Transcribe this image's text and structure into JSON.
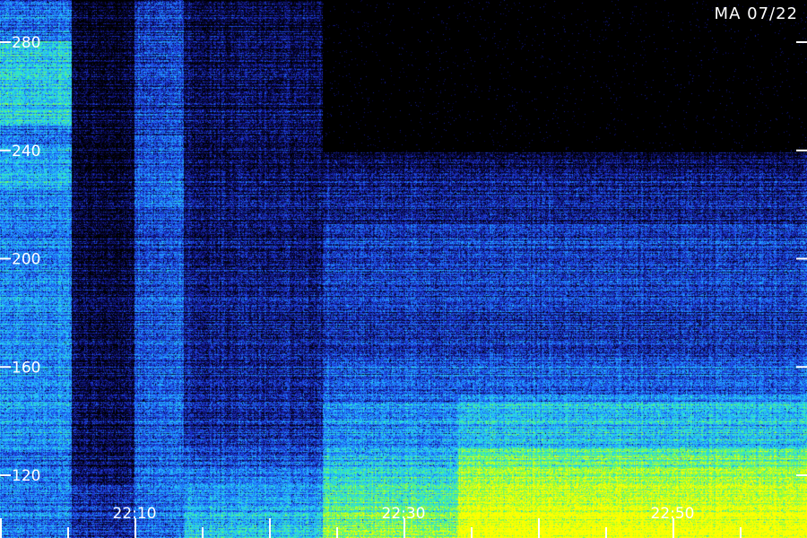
{
  "stamp": "MA 07/22",
  "chart_data": {
    "type": "heatmap",
    "title": "",
    "xlabel": "",
    "ylabel": "",
    "y_ticks": [
      120,
      160,
      200,
      240,
      280
    ],
    "y_range": [
      98,
      294
    ],
    "x_tick_labels": [
      "22:10",
      "22:30",
      "22:50"
    ],
    "x_range_minutes_past_2200": [
      0,
      60
    ],
    "colormap": [
      "#000000",
      "#0a0a5a",
      "#1e32d2",
      "#1e7cff",
      "#28c8ff",
      "#32f0b4",
      "#96ff32",
      "#ffff00"
    ],
    "segments": [
      {
        "from": "22:00",
        "to": "22:05",
        "description_level": "bright"
      },
      {
        "from": "22:05",
        "to": "22:08",
        "description_level": "dark"
      },
      {
        "from": "22:08",
        "to": "22:13",
        "description_level": "medium"
      },
      {
        "from": "22:13",
        "to": "22:24",
        "description_level": "dim"
      },
      {
        "from": "22:24",
        "to": "22:34",
        "description_level": "medium, no data above 250"
      },
      {
        "from": "22:34",
        "to": "23:00",
        "description_level": "bright low band, no data above 250"
      }
    ]
  }
}
